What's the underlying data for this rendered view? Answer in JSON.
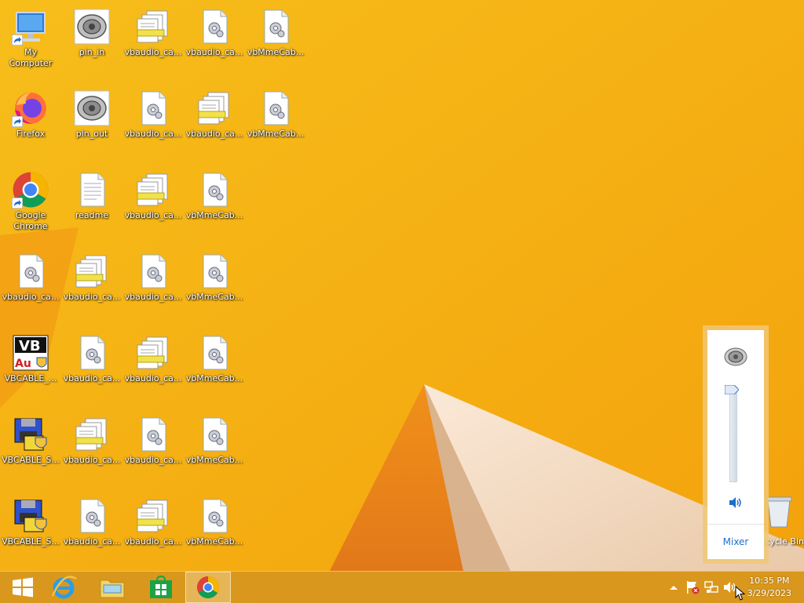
{
  "desktop": {
    "icons": [
      {
        "label": "My Computer",
        "icon": "computer-icon"
      },
      {
        "label": "pin_in",
        "icon": "audio-device-icon"
      },
      {
        "label": "vbaudio_ca...",
        "icon": "config-files-icon"
      },
      {
        "label": "vbaudio_ca...",
        "icon": "settings-file-icon"
      },
      {
        "label": "vbMmeCab...",
        "icon": "settings-file-icon"
      },
      {
        "label": "Firefox",
        "icon": "firefox-icon"
      },
      {
        "label": "pin_out",
        "icon": "audio-device-icon"
      },
      {
        "label": "vbaudio_ca...",
        "icon": "settings-file-icon"
      },
      {
        "label": "vbaudio_ca...",
        "icon": "config-files-icon"
      },
      {
        "label": "vbMmeCab...",
        "icon": "settings-file-icon"
      },
      {
        "label": "Google Chrome",
        "icon": "chrome-icon"
      },
      {
        "label": "readme",
        "icon": "text-file-icon"
      },
      {
        "label": "vbaudio_ca...",
        "icon": "config-files-icon"
      },
      {
        "label": "vbMmeCab...",
        "icon": "settings-file-icon"
      },
      {
        "label": "vbaudio_ca...",
        "icon": "settings-file-icon"
      },
      {
        "label": "vbaudio_ca...",
        "icon": "config-files-icon"
      },
      {
        "label": "vbaudio_ca...",
        "icon": "settings-file-icon"
      },
      {
        "label": "vbMmeCab...",
        "icon": "settings-file-icon"
      },
      {
        "label": "VBCABLE_...",
        "icon": "vb-audio-icon"
      },
      {
        "label": "vbaudio_ca...",
        "icon": "settings-file-icon"
      },
      {
        "label": "vbaudio_ca...",
        "icon": "config-files-icon"
      },
      {
        "label": "vbMmeCab...",
        "icon": "settings-file-icon"
      },
      {
        "label": "VBCABLE_S...",
        "icon": "setup-icon"
      },
      {
        "label": "vbaudio_ca...",
        "icon": "config-files-icon"
      },
      {
        "label": "vbaudio_ca...",
        "icon": "settings-file-icon"
      },
      {
        "label": "vbMmeCab...",
        "icon": "settings-file-icon"
      },
      {
        "label": "VBCABLE_S...",
        "icon": "setup-icon"
      },
      {
        "label": "vbaudio_ca...",
        "icon": "settings-file-icon"
      },
      {
        "label": "vbaudio_ca...",
        "icon": "config-files-icon"
      },
      {
        "label": "vbMmeCab...",
        "icon": "settings-file-icon"
      }
    ],
    "recycle_bin_label": "Recycle Bin"
  },
  "volume": {
    "level": 1.0,
    "mixer_label": "Mixer"
  },
  "taskbar": {
    "start_icon": "windows-logo-icon",
    "pinned": [
      "internet-explorer-icon",
      "file-explorer-icon",
      "store-icon",
      "chrome-icon"
    ]
  },
  "clock": {
    "time": "10:35 PM",
    "date": "3/29/2023"
  },
  "colors": {
    "accent": "#f5b40e",
    "link": "#1d6fcc"
  }
}
